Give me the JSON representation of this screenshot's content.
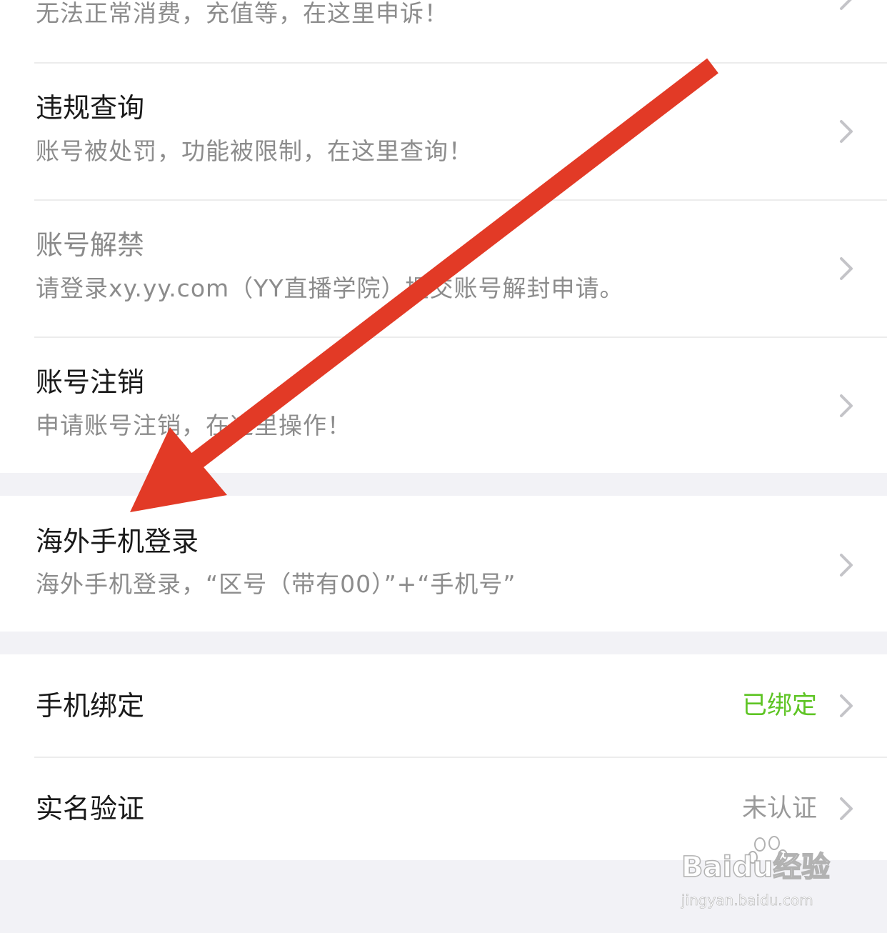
{
  "settings": {
    "items": [
      {
        "title": "",
        "subtitle": "无法正常消费，充值等，在这里申诉！",
        "value": ""
      },
      {
        "title": "违规查询",
        "subtitle": "账号被处罚，功能被限制，在这里查询！",
        "value": ""
      },
      {
        "title": "账号解禁",
        "subtitle": "请登录xy.yy.com（YY直播学院）提交账号解封申请。",
        "value": ""
      },
      {
        "title": "账号注销",
        "subtitle": "申请账号注销，在这里操作！",
        "value": ""
      },
      {
        "title": "海外手机登录",
        "subtitle": "海外手机登录，“区号（带有00）”+“手机号”",
        "value": ""
      },
      {
        "title": "手机绑定",
        "subtitle": "",
        "value": "已绑定"
      },
      {
        "title": "实名验证",
        "subtitle": "",
        "value": "未认证"
      }
    ]
  },
  "colors": {
    "bound_value": "#5ec424",
    "unverified_value": "#9a9a9a",
    "annotation_arrow": "#e23a26"
  },
  "icons": {
    "row_chevron": "chevron-right-icon",
    "annotation": "red-arrow-annotation",
    "watermark_logo": "baidu-paw-icon"
  },
  "watermark": {
    "brand": "Baidu经验",
    "url": "jingyan.baidu.com"
  }
}
